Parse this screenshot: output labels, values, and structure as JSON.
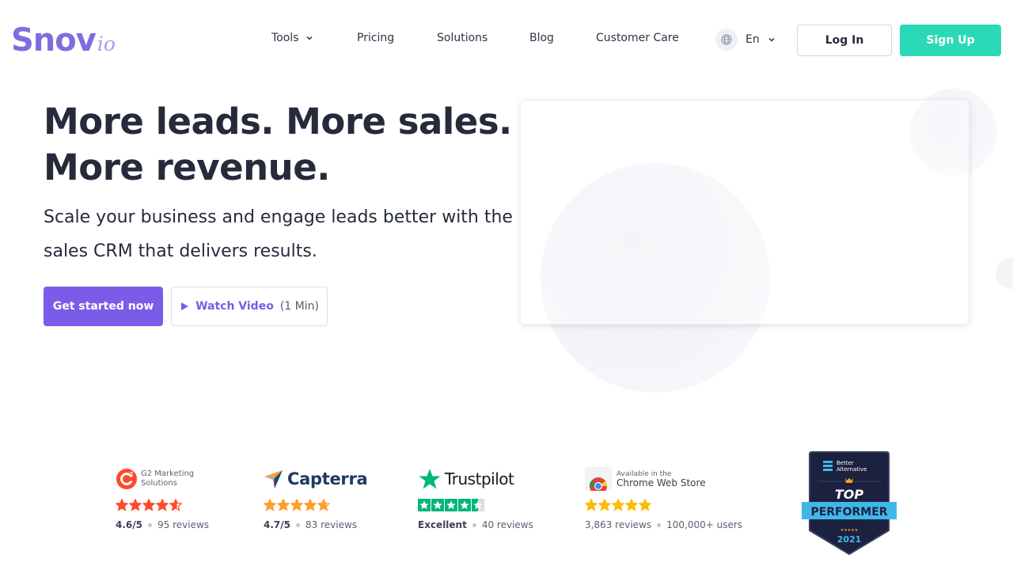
{
  "header": {
    "logo_main": "Snov",
    "logo_suffix": "io",
    "nav": [
      {
        "label": "Tools",
        "has_dropdown": true
      },
      {
        "label": "Pricing"
      },
      {
        "label": "Solutions"
      },
      {
        "label": "Blog"
      },
      {
        "label": "Customer Care"
      }
    ],
    "language": "En",
    "login_label": "Log In",
    "signup_label": "Sign Up"
  },
  "hero": {
    "title_line1": "More leads. More sales.",
    "title_line2": "More revenue.",
    "subtitle_line1": "Scale your business and engage leads better with the",
    "subtitle_line2": "sales CRM that delivers results.",
    "cta_primary": "Get started now",
    "cta_video": "Watch Video",
    "cta_video_duration": "(1 Min)"
  },
  "ratings": [
    {
      "source": "G2",
      "logo_line1": "G2 Marketing",
      "logo_line2": "Solutions",
      "score": "4.6/5",
      "reviews": "95 reviews",
      "stars": 4.6,
      "star_color": "#ff492c"
    },
    {
      "source": "Capterra",
      "logo_text": "Capterra",
      "score": "4.7/5",
      "reviews": "83 reviews",
      "stars": 4.7,
      "star_color": "#ff9d28"
    },
    {
      "source": "Trustpilot",
      "logo_text": "Trustpilot",
      "score": "Excellent",
      "reviews": "40 reviews",
      "stars": 4.5,
      "star_color": "#00b67a"
    },
    {
      "source": "Chrome Web Store",
      "logo_line1": "Available in the",
      "logo_line2": "Chrome Web Store",
      "score": "3,863 reviews",
      "reviews": "100,000+ users",
      "stars": 5,
      "star_color": "#fbbc04"
    }
  ],
  "badge": {
    "line1": "Better",
    "line2": "Alternative",
    "top": "TOP",
    "performer": "PERFORMER",
    "year": "2021"
  },
  "colors": {
    "brand_purple": "#7b5ce8",
    "signup_green": "#2ad9b5",
    "logo_purple": "#7d6ee0"
  }
}
